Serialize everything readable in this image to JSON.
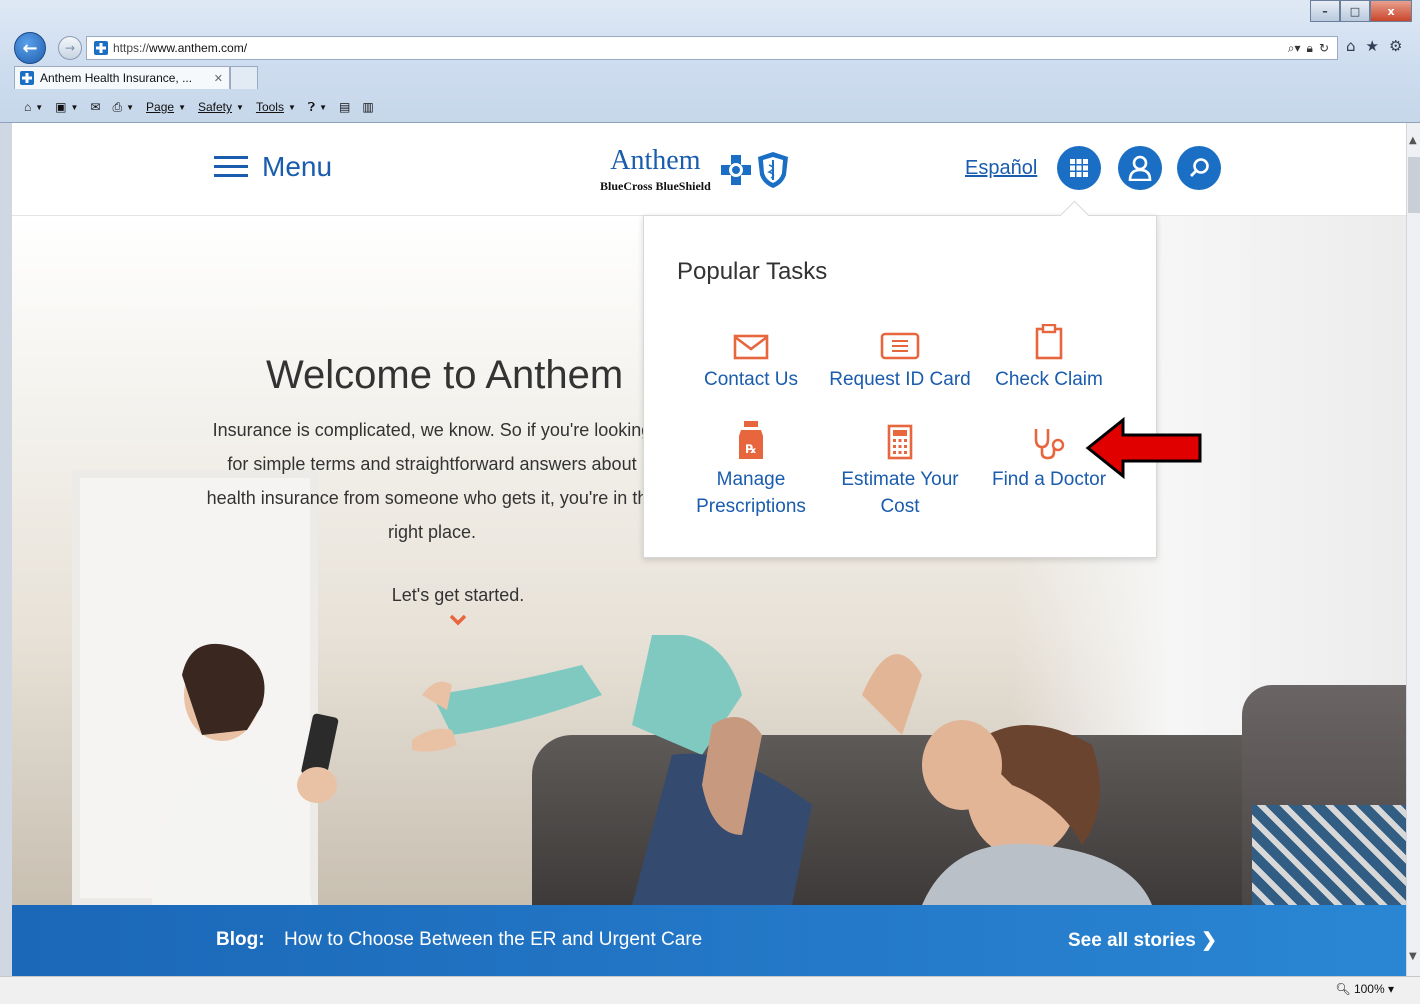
{
  "browser": {
    "url_prefix": "https://",
    "url_host": "www.anthem.com/",
    "tab_title": "Anthem Health Insurance, ...",
    "window_controls": [
      "–",
      "□",
      "x"
    ],
    "command_bar": {
      "page_label": "Page",
      "safety_label": "Safety",
      "tools_label": "Tools"
    },
    "zoom": "100%"
  },
  "header": {
    "menu_label": "Menu",
    "logo_word": "Anthem",
    "logo_sub": "BlueCross BlueShield",
    "espanol_label": "Español"
  },
  "hero": {
    "title": "Welcome to Anthem",
    "body_lines": [
      "Insurance is complicated, we know. So if you're looking",
      "for simple terms and straightforward answers about",
      "health insurance from someone who gets it, you're in the",
      "right place."
    ],
    "cta": "Let's get started."
  },
  "popular_tasks": {
    "title": "Popular Tasks",
    "items": [
      {
        "line1": "Contact Us",
        "line2": "",
        "icon": "envelope-icon"
      },
      {
        "line1": "Request ID Card",
        "line2": "",
        "icon": "id-card-icon"
      },
      {
        "line1": "Check Claim",
        "line2": "",
        "icon": "clipboard-icon"
      },
      {
        "line1": "Manage",
        "line2": "Prescriptions",
        "icon": "rx-bottle-icon"
      },
      {
        "line1": "Estimate Your",
        "line2": "Cost",
        "icon": "calculator-icon"
      },
      {
        "line1": "Find a Doctor",
        "line2": "",
        "icon": "stethoscope-icon"
      }
    ]
  },
  "blog": {
    "label": "Blog:",
    "headline": "How to Choose Between the ER and Urgent Care",
    "see_all": "See all stories"
  },
  "colors": {
    "brand_blue": "#1a5cad",
    "task_icon_orange": "#e8663d",
    "annotation_red": "#e00000"
  }
}
